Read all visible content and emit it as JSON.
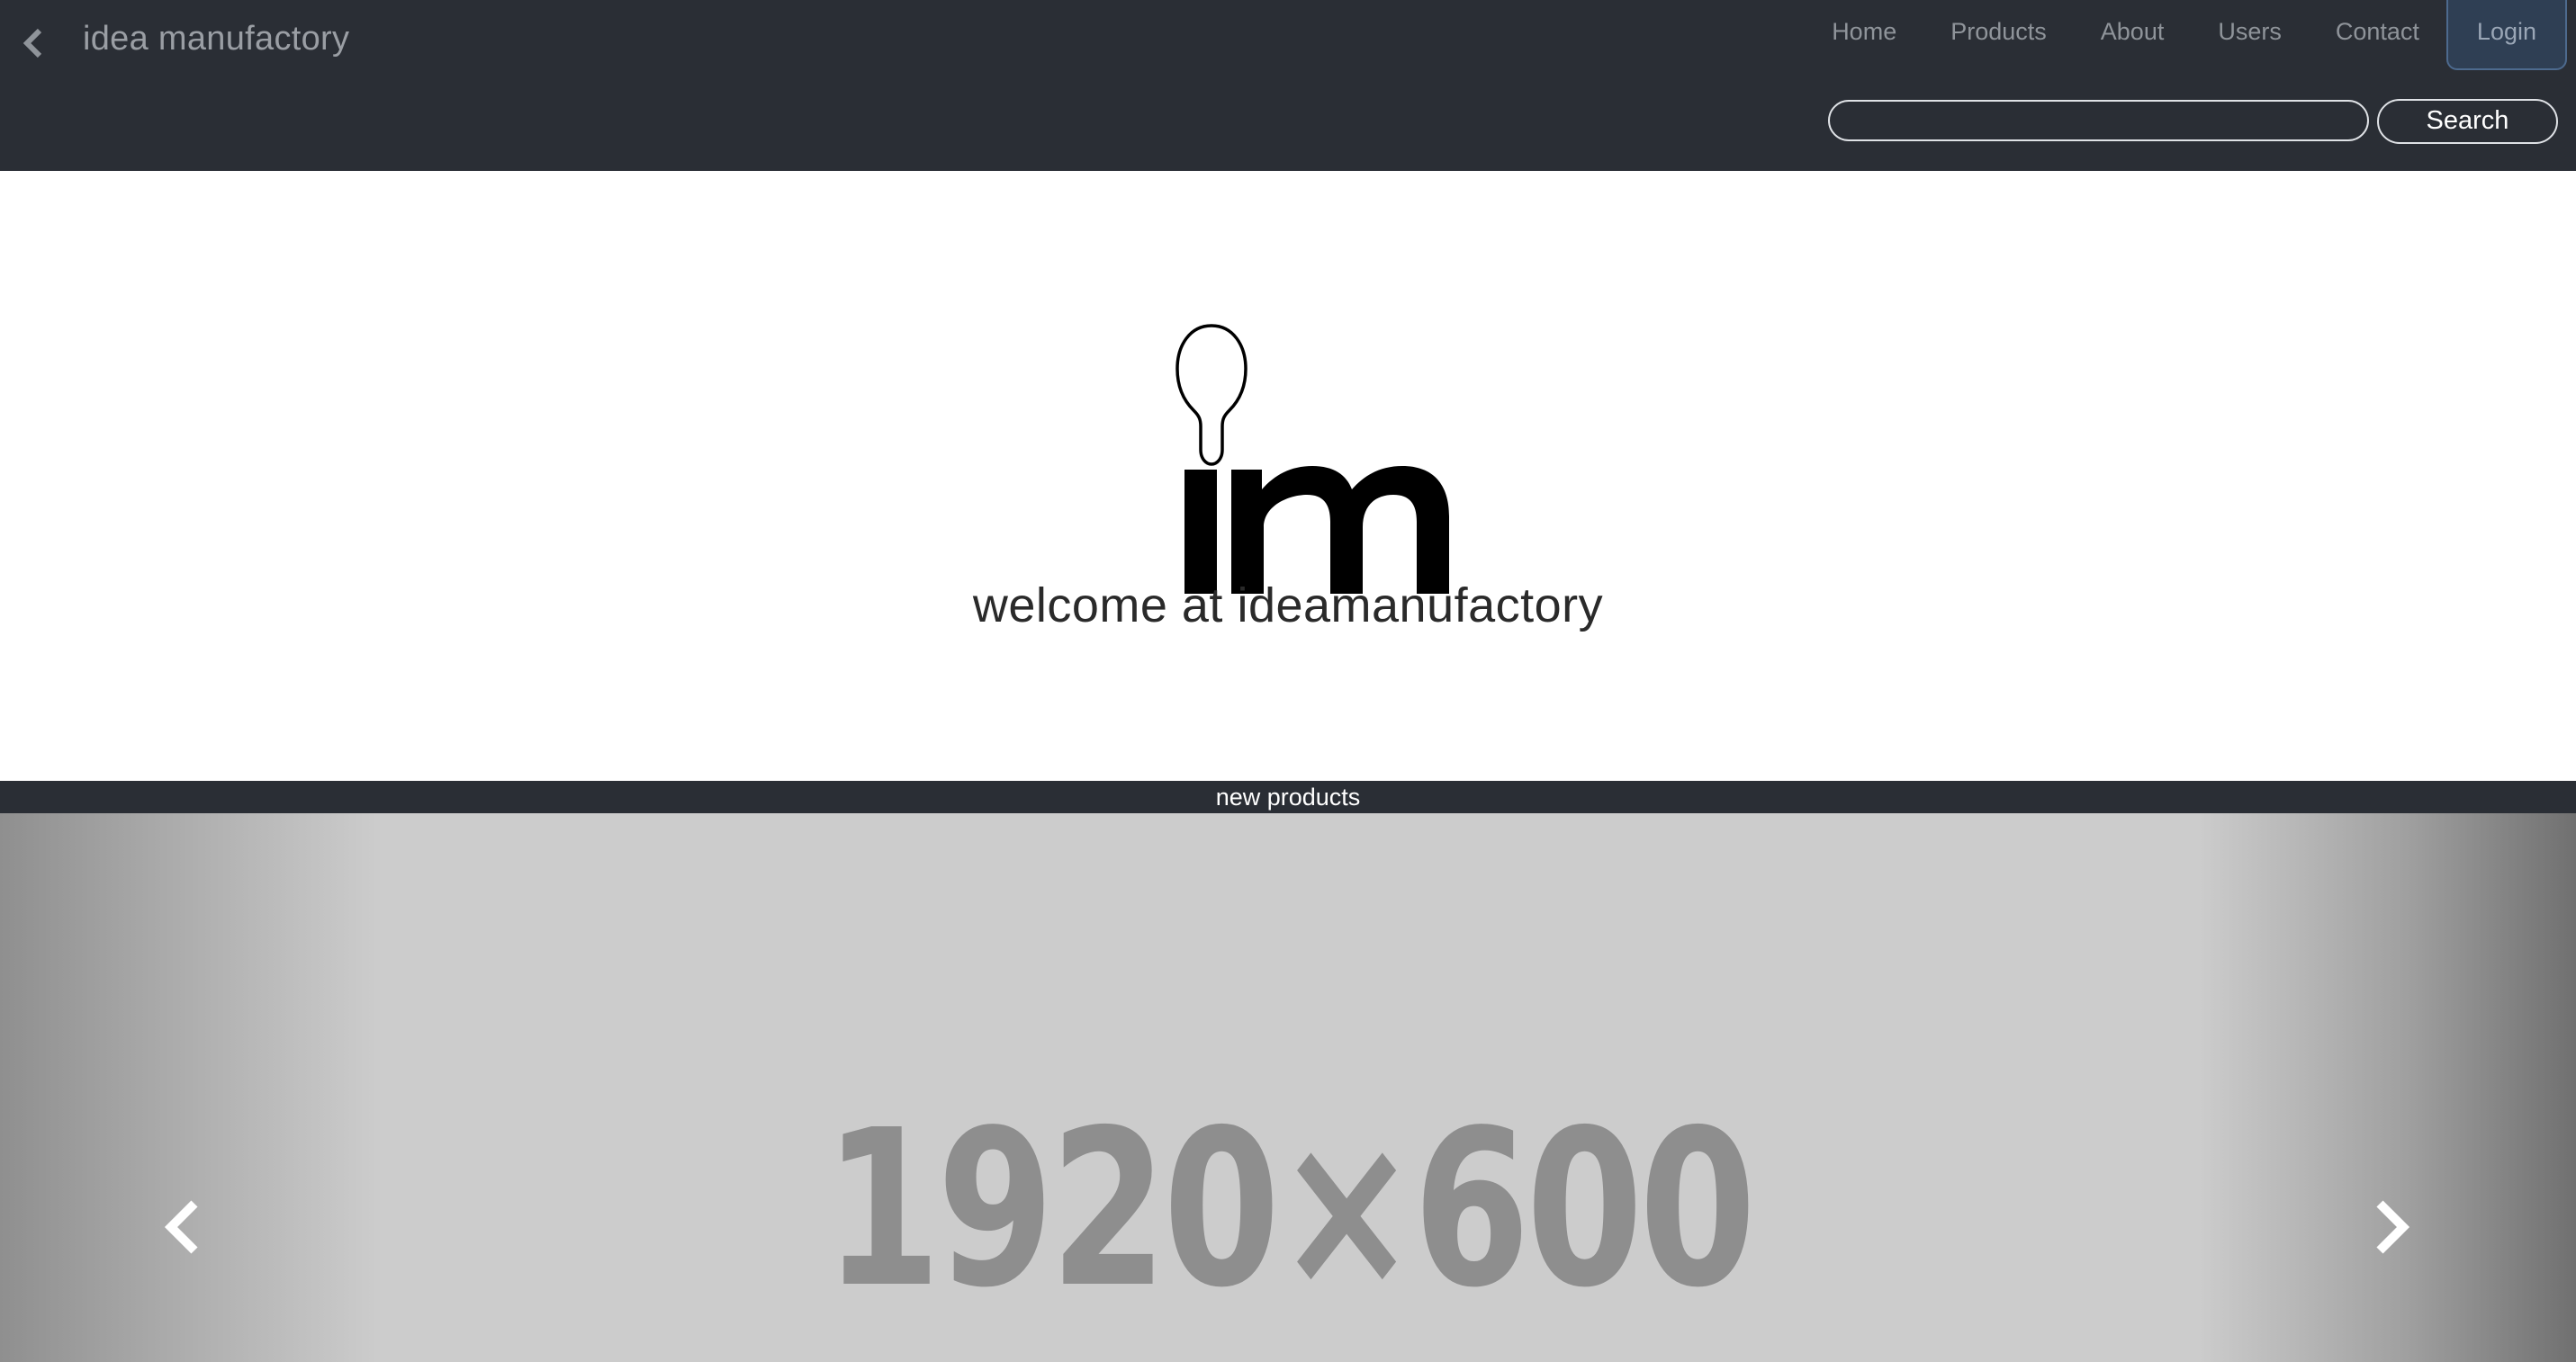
{
  "navbar": {
    "brand": "idea manufactory",
    "links": [
      {
        "label": "Home"
      },
      {
        "label": "Products"
      },
      {
        "label": "About"
      },
      {
        "label": "Users"
      },
      {
        "label": "Contact"
      }
    ],
    "login_label": "Login",
    "search": {
      "value": "",
      "button_label": "Search"
    }
  },
  "hero": {
    "welcome_text": "welcome at ideamanufactory",
    "logo_text": "im"
  },
  "section": {
    "title": "new products"
  },
  "carousel": {
    "placeholder_text": "1920×600"
  },
  "colors": {
    "navbar_bg": "#2a2e35",
    "login_bg": "#2f3f54",
    "carousel_bg": "#cccccc"
  }
}
